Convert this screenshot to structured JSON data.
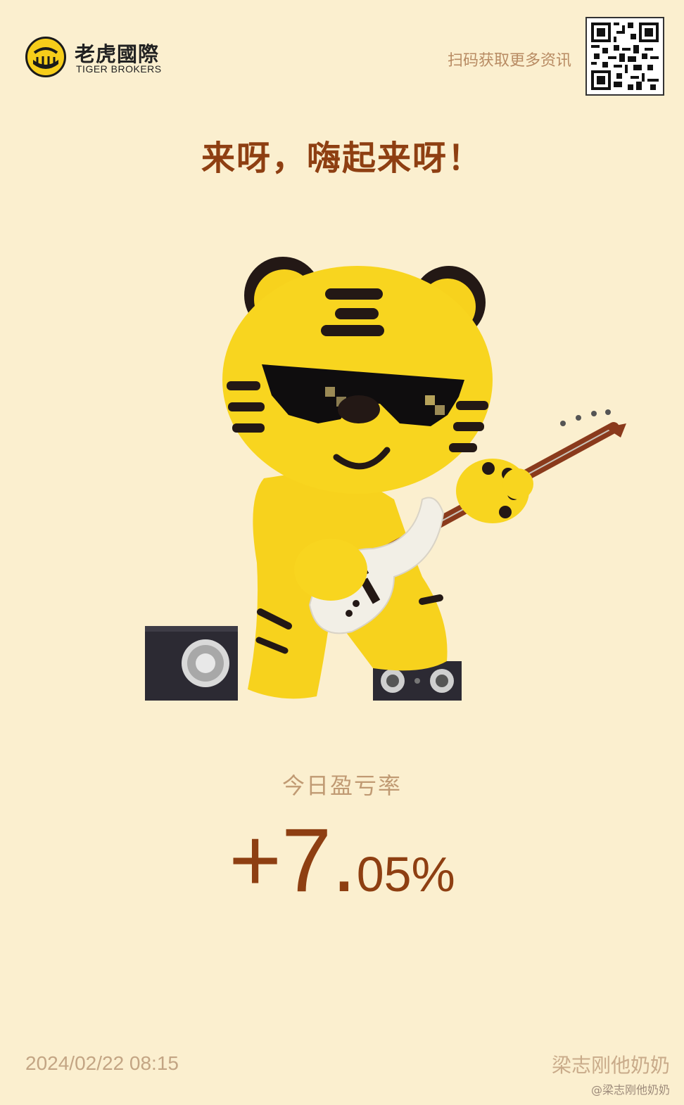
{
  "brand": {
    "name_cn": "老虎國際",
    "name_en": "TIGER BROKERS",
    "logo_color": "#f6cd1a"
  },
  "header": {
    "scan_prompt": "扫码获取更多资讯"
  },
  "headline": "来呀，嗨起来呀！",
  "stat": {
    "label": "今日盈亏率",
    "sign_int": "+7.",
    "decimals": "05%",
    "accent_color": "#8e3f12"
  },
  "footer": {
    "timestamp": "2024/02/22 08:15",
    "watermark": "梁志刚他奶奶",
    "watermark_sub": "@梁志刚他奶奶"
  },
  "icons": {
    "logo": "tiger-logo-icon",
    "qr": "qr-code-icon",
    "illustration": "tiger-guitar-illustration"
  }
}
